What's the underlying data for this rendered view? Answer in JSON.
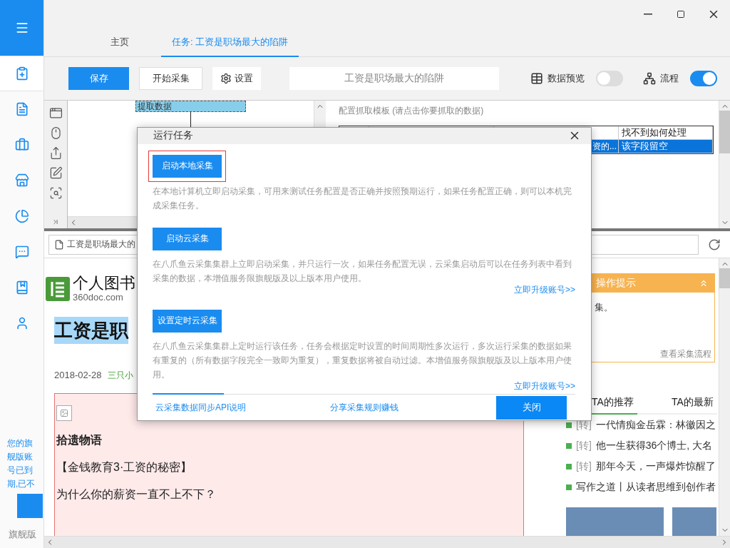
{
  "sidebar": {
    "items": [
      {
        "selected": true
      },
      {
        "selected": false
      },
      {
        "selected": false
      },
      {
        "selected": false
      },
      {
        "selected": false
      },
      {
        "selected": false
      },
      {
        "selected": false
      },
      {
        "selected": false
      }
    ],
    "notice": "您的旗舰版账号已到期,已不",
    "edition": "旗舰版"
  },
  "tabs": [
    {
      "label": "主页",
      "selected": false
    },
    {
      "label": "任务: 工资是职场最大的陷阱",
      "selected": true
    }
  ],
  "toolbar": {
    "save": "保存",
    "start": "开始采集",
    "settings": "设置",
    "task_name": "工资是职场最大的陷阱",
    "toggles": [
      {
        "label": "数据预览",
        "on": false
      },
      {
        "label": "流程",
        "on": true
      }
    ]
  },
  "workflow": {
    "node": "提取数据"
  },
  "template": {
    "title": "配置抓取模板 (请点击你要抓取的数据)",
    "header": "找不到如何处理",
    "rows": [
      {
        "cells": [
          "资的...",
          "该字段留空"
        ],
        "selected": true
      }
    ]
  },
  "browser": {
    "url": "工资是职场最大的",
    "site_name": "个人图书",
    "site_domain": "360doc.com",
    "title": "工资是职",
    "date": "2018-02-28",
    "author": "三只小",
    "paragraphs": [
      {
        "kind": "heading",
        "text": "拾遗物语"
      },
      {
        "kind": "text",
        "text": "【金钱教育3·工资的秘密】"
      },
      {
        "kind": "text",
        "text": "为什么你的薪资一直不上不下？"
      }
    ],
    "tip": {
      "title": "操作提示",
      "text": "集。",
      "link": "查看采集流程"
    },
    "side_tabs": [
      {
        "label": "TA的推荐",
        "selected": true
      },
      {
        "label": "TA的最新",
        "selected": false
      }
    ],
    "recommendations": [
      {
        "tag": "[转]",
        "title": "一代情痴金岳霖：林徽因之"
      },
      {
        "tag": "[转]",
        "title": "他一生获得36个博士, 大名"
      },
      {
        "tag": "[转]",
        "title": "那年今天，一声爆炸惊醒了"
      },
      {
        "title": "写作之道丨从读者思维到创作者"
      }
    ]
  },
  "dialog": {
    "title": "运行任务",
    "options": [
      {
        "button": "启动本地采集",
        "highlighted": true,
        "description": "在本地计算机立即启动采集，可用来测试任务配置是否正确并按照预期运行，如果任务配置正确，则可以本机完成采集任务。"
      },
      {
        "button": "启动云采集",
        "highlighted": false,
        "description": "在八爪鱼云采集集群上立即启动采集，并只运行一次，如果任务配置无误，云采集启动后可以在任务列表中看到采集的数据，本增值服务限旗舰版及以上版本用户使用。",
        "link": "立即升级账号>>"
      },
      {
        "button": "设置定时云采集",
        "highlighted": false,
        "description": "在八爪鱼云采集集群上定时运行该任务，任务会根据定时设置的时间周期性多次运行，多次运行采集的数据如果有重复的（所有数据字段完全一致即为重复），重复数据将被自动过滤。本增值服务限旗舰版及以上版本用户使用。",
        "link": "立即升级账号>>"
      }
    ],
    "footer_links": [
      "云采集数据同步API说明",
      "分享采集规则赚钱"
    ],
    "close": "关闭"
  }
}
